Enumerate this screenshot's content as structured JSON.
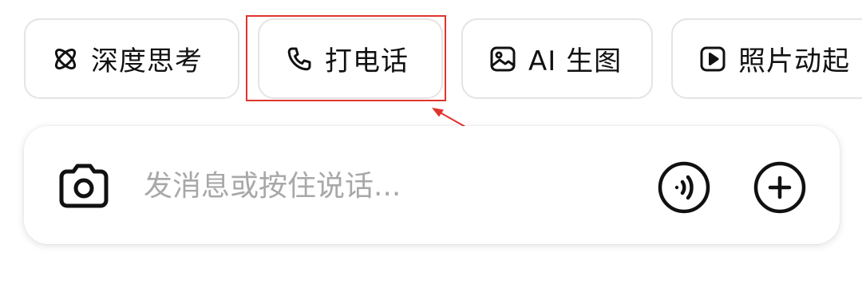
{
  "quick_actions": [
    {
      "label": "深度思考",
      "icon": "atom-icon"
    },
    {
      "label": "打电话",
      "icon": "phone-icon"
    },
    {
      "label": "AI 生图",
      "icon": "image-icon"
    },
    {
      "label": "照片动起",
      "icon": "play-icon"
    }
  ],
  "composer": {
    "placeholder": "发消息或按住说话...",
    "value": "",
    "camera_icon": "camera-icon",
    "voice_icon": "voice-wave-icon",
    "add_icon": "plus-icon"
  },
  "annotation": {
    "highlighted_item": "打电话",
    "color": "#e0342e"
  }
}
